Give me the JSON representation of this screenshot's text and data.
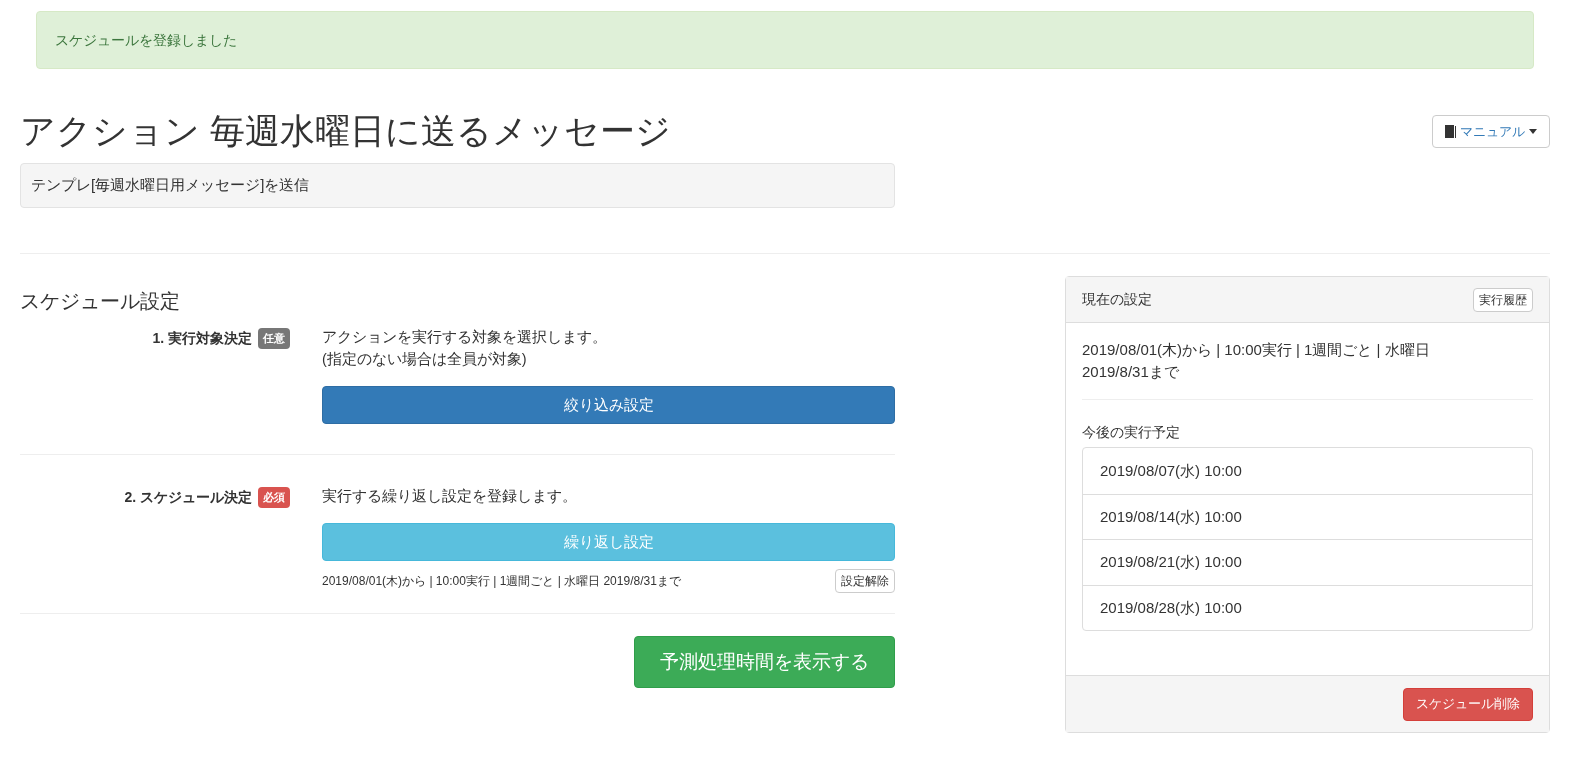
{
  "alert": {
    "text": "スケジュールを登録しました"
  },
  "header": {
    "title": "アクション 毎週水曜日に送るメッセージ",
    "manual_button": "マニュアル",
    "description": "テンプレ[毎週水曜日用メッセージ]を送信"
  },
  "schedule_settings": {
    "heading": "スケジュール設定",
    "steps": [
      {
        "label": "1. 実行対象決定",
        "badge": {
          "text": "任意",
          "kind": "optional"
        },
        "lines": [
          "アクションを実行する対象を選択します。",
          "(指定のない場合は全員が対象)"
        ],
        "button": {
          "label": "絞り込み設定",
          "kind": "primary"
        }
      },
      {
        "label": "2. スケジュール決定",
        "badge": {
          "text": "必須",
          "kind": "required"
        },
        "lines": [
          "実行する繰り返し設定を登録します。"
        ],
        "button": {
          "label": "繰り返し設定",
          "kind": "info"
        },
        "summary": "2019/08/01(木)から | 10:00実行 | 1週間ごと | 水曜日 2019/8/31まで",
        "clear_button": "設定解除"
      }
    ],
    "estimate_button": "予測処理時間を表示する"
  },
  "current_panel": {
    "title": "現在の設定",
    "history_button": "実行履歴",
    "summary_lines": [
      "2019/08/01(木)から | 10:00実行 | 1週間ごと | 水曜日",
      "2019/8/31まで"
    ],
    "upcoming_heading": "今後の実行予定",
    "upcoming": [
      "2019/08/07(水) 10:00",
      "2019/08/14(水) 10:00",
      "2019/08/21(水) 10:00",
      "2019/08/28(水) 10:00"
    ],
    "delete_button": "スケジュール削除"
  }
}
